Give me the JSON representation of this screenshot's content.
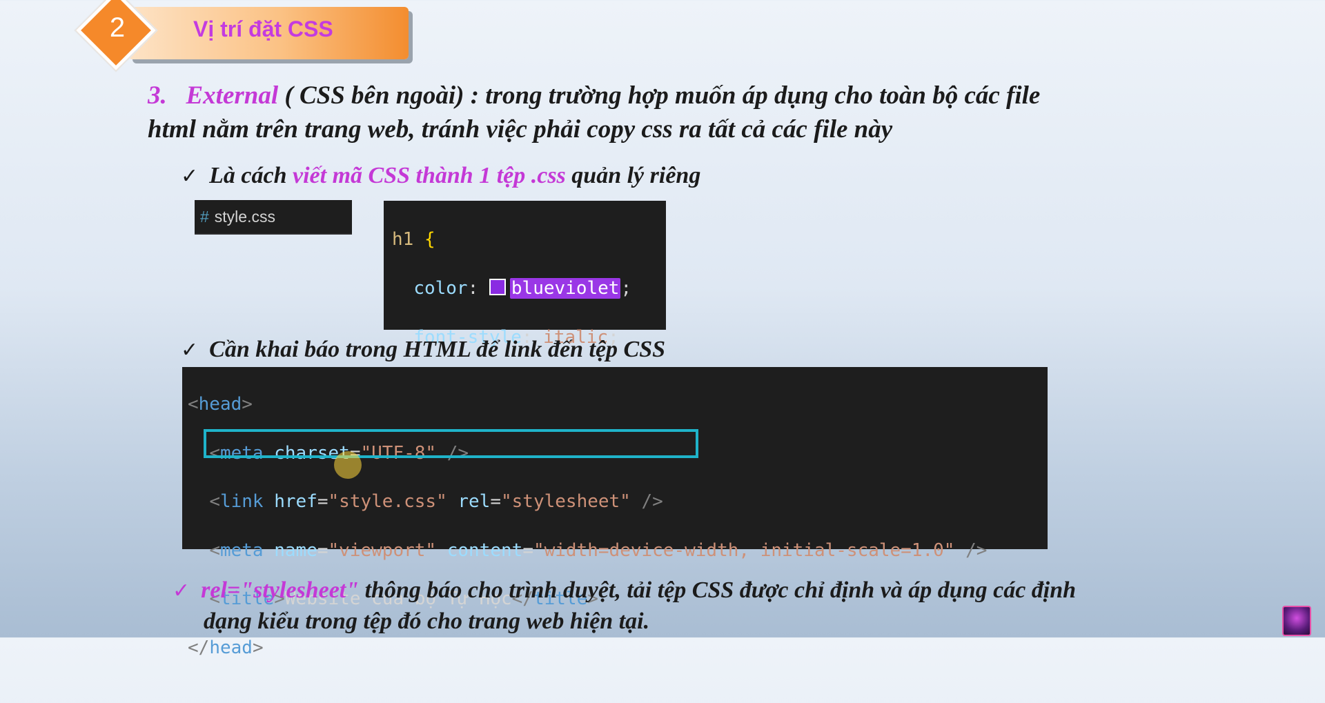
{
  "header": {
    "number": "2",
    "title": "Vị trí đặt CSS"
  },
  "intro": {
    "num": "3.",
    "term": "External",
    "rest_line1": " ( CSS bên ngoài) : trong trường hợp muốn áp dụng cho toàn bộ các file",
    "line2": "html nằm trên trang web, tránh việc phải copy css ra tất cả các file này"
  },
  "bullet1": {
    "check": "✓",
    "before": "Là cách ",
    "highlight": "viết mã CSS thành 1 tệp .css",
    "after": " quản lý riêng"
  },
  "file_tab": {
    "hash": "#",
    "filename": "style.css"
  },
  "css_code": {
    "selector": "h1",
    "open_brace": "{",
    "prop1": "color",
    "val1": "blueviolet",
    "prop2": "font-style",
    "val2": "italic",
    "close_brace": "}",
    "swatch_color": "#8a2be2"
  },
  "bullet2": {
    "check": "✓",
    "text": "Cần khai báo trong HTML để link đến tệp CSS"
  },
  "html_code": {
    "head_tag": "head",
    "meta1_tag": "meta",
    "meta1_attr": "charset",
    "meta1_val": "\"UTF-8\"",
    "link_tag": "link",
    "link_attr1": "href",
    "link_val1": "\"style.css\"",
    "link_attr2": "rel",
    "link_val2": "\"stylesheet\"",
    "meta2_tag": "meta",
    "meta2_attr1": "name",
    "meta2_val1": "\"viewport\"",
    "meta2_attr2": "content",
    "meta2_val2": "\"width=device-width, initial-scale=1.0\"",
    "title_tag": "title",
    "title_text": "Website của bộ Tự Học"
  },
  "bullet3": {
    "check": "✓",
    "term": "rel=\"stylesheet\"",
    "line1_rest": " thông báo cho trình duyệt, tải tệp CSS được chỉ định và áp dụng các định",
    "line2": "dạng kiểu trong tệp đó cho trang web hiện tại."
  },
  "colors": {
    "accent_pink": "#c439d6",
    "badge_orange": "#f5892a",
    "highlight_box": "#1fb3c9"
  }
}
